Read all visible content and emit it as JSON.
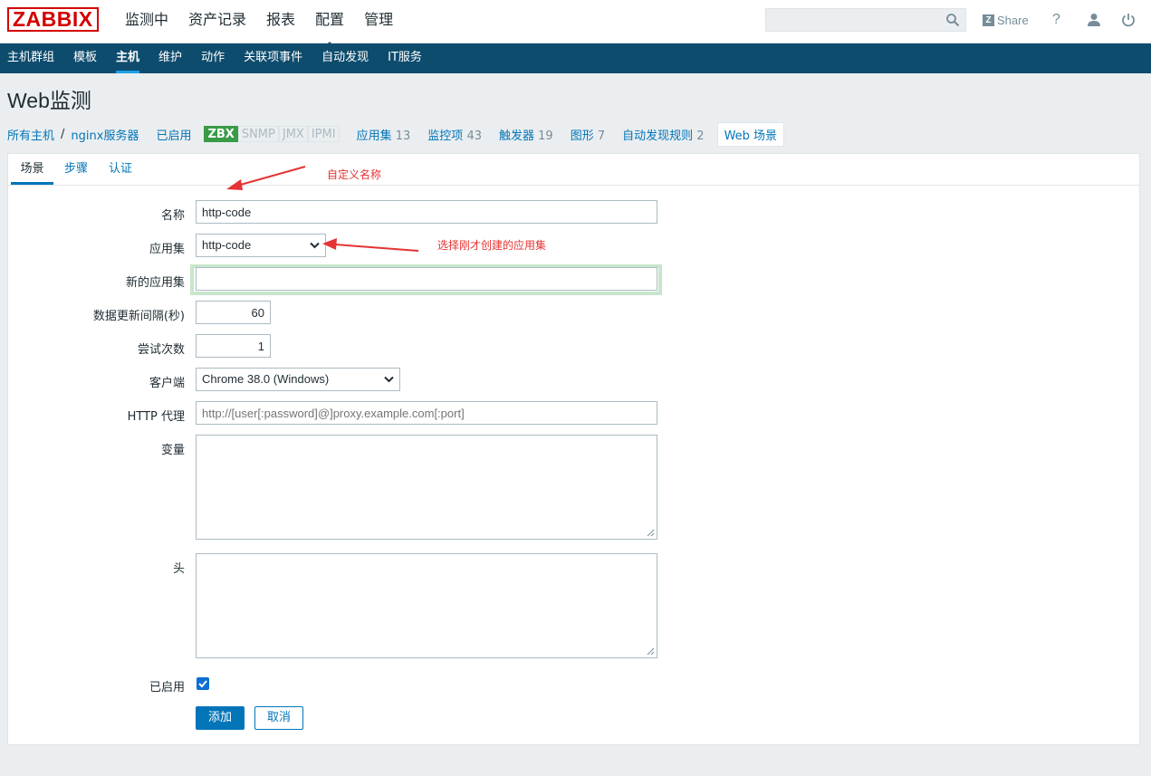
{
  "header": {
    "logo": "ZABBIX",
    "menu": [
      "监测中",
      "资产记录",
      "报表",
      "配置",
      "管理"
    ],
    "active_menu_index": 3,
    "share_label": "Share",
    "help_label": "?"
  },
  "subnav": {
    "items": [
      "主机群组",
      "模板",
      "主机",
      "维护",
      "动作",
      "关联项事件",
      "自动发现",
      "IT服务"
    ],
    "active_index": 2
  },
  "page": {
    "title": "Web监测"
  },
  "host_nav": {
    "all_hosts": "所有主机",
    "separator": "/",
    "host": "nginx服务器",
    "status": "已启用",
    "protocols": [
      "ZBX",
      "SNMP",
      "JMX",
      "IPMI"
    ],
    "links": [
      {
        "label": "应用集",
        "count": "13"
      },
      {
        "label": "监控项",
        "count": "43"
      },
      {
        "label": "触发器",
        "count": "19"
      },
      {
        "label": "图形",
        "count": "7"
      },
      {
        "label": "自动发现规则",
        "count": "2"
      }
    ],
    "web_tab": "Web 场景"
  },
  "tabs": [
    "场景",
    "步骤",
    "认证"
  ],
  "form": {
    "name_label": "名称",
    "name_value": "http-code",
    "app_label": "应用集",
    "app_value": "http-code",
    "new_app_label": "新的应用集",
    "new_app_value": "",
    "interval_label": "数据更新间隔(秒)",
    "interval_value": "60",
    "attempts_label": "尝试次数",
    "attempts_value": "1",
    "agent_label": "客户端",
    "agent_value": "Chrome 38.0 (Windows)",
    "proxy_label": "HTTP 代理",
    "proxy_placeholder": "http://[user[:password]@]proxy.example.com[:port]",
    "variables_label": "变量",
    "headers_label": "头",
    "enabled_label": "已启用",
    "enabled": true,
    "add_button": "添加",
    "cancel_button": "取消"
  },
  "annotations": {
    "name_note": "自定义名称",
    "app_note": "选择刚才创建的应用集"
  }
}
